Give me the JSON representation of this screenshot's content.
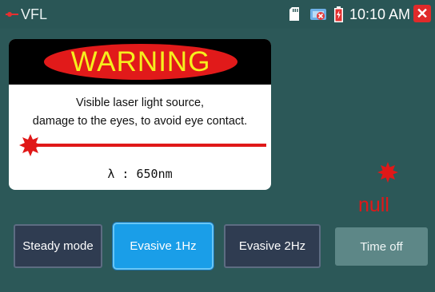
{
  "statusbar": {
    "app_title": "VFL",
    "time": "10:10 AM",
    "icons": [
      "laser-icon",
      "sd-card-icon",
      "connection-off-icon",
      "battery-charging-icon",
      "close-icon"
    ],
    "close_symbol": "✕"
  },
  "warning_card": {
    "heading": "WARNING",
    "line1": "Visible laser light source,",
    "line2": "damage to the eyes, to avoid eye contact.",
    "wavelength": "λ : 650nm"
  },
  "status": {
    "value": "null",
    "color": "#e01818"
  },
  "buttons": {
    "steady": "Steady mode",
    "evasive1": "Evasive 1Hz",
    "evasive2": "Evasive 2Hz",
    "time_off": "Time off",
    "selected": "Evasive 1Hz"
  },
  "colors": {
    "background": "#2c5858",
    "accent": "#1a9ee8",
    "warning_red": "#e11a1a",
    "warning_yellow": "#f5ef1e"
  }
}
